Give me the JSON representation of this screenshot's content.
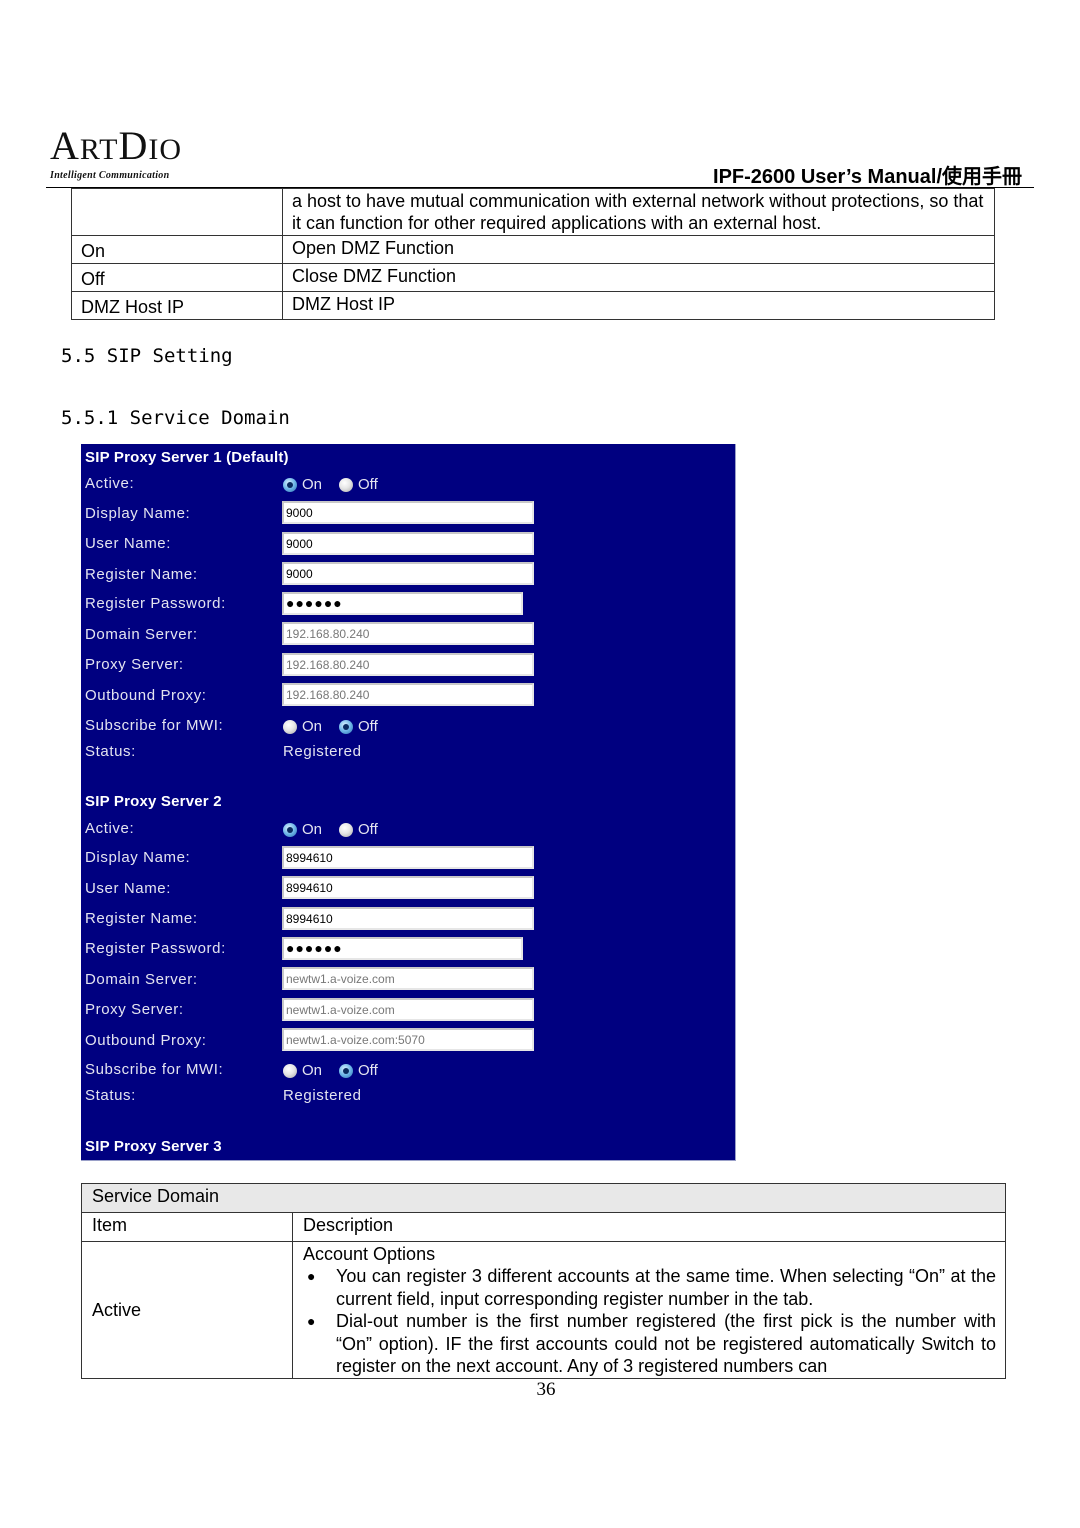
{
  "header": {
    "logo_main": "ArtDio",
    "logo_tagline": "Intelligent Communication",
    "manual_title": "IPF-2600 User’s Manual/使用手冊"
  },
  "dmz_table": {
    "rows": [
      {
        "item": "",
        "description": "a host to have mutual communication with external network without protections, so that it can function for other required applications with an external host."
      },
      {
        "item": "On",
        "description": "Open DMZ Function"
      },
      {
        "item": "Off",
        "description": "Close DMZ Function"
      },
      {
        "item": "DMZ Host IP",
        "description": "DMZ Host IP"
      }
    ]
  },
  "headings": {
    "section": "5.5 SIP Setting",
    "subsection": "5.5.1 Service Domain"
  },
  "sip_panel": {
    "colors": {
      "background": "#000080",
      "text": "#e4e4f0"
    },
    "labels": {
      "active": "Active:",
      "display_name": "Display Name:",
      "user_name": "User Name:",
      "register_name": "Register Name:",
      "register_password": "Register Password:",
      "domain_server": "Domain Server:",
      "proxy_server": "Proxy Server:",
      "outbound_proxy": "Outbound Proxy:",
      "subscribe_mwi": "Subscribe for MWI:",
      "status": "Status:",
      "on": "On",
      "off": "Off"
    },
    "servers": [
      {
        "title": "SIP Proxy Server 1 (Default)",
        "active": "On",
        "display_name": "9000",
        "user_name": "9000",
        "register_name": "9000",
        "register_password": "●●●●●●",
        "domain_server": "192.168.80.240",
        "proxy_server": "192.168.80.240",
        "outbound_proxy": "192.168.80.240",
        "subscribe_mwi": "Off",
        "status": "Registered"
      },
      {
        "title": "SIP Proxy Server 2",
        "active": "On",
        "display_name": "8994610",
        "user_name": "8994610",
        "register_name": "8994610",
        "register_password": "●●●●●●",
        "domain_server": "newtw1.a-voize.com",
        "proxy_server": "newtw1.a-voize.com",
        "outbound_proxy": "newtw1.a-voize.com:5070",
        "subscribe_mwi": "Off",
        "status": "Registered"
      },
      {
        "title": "SIP Proxy Server 3"
      }
    ]
  },
  "service_table": {
    "title": "Service Domain",
    "col_item": "Item",
    "col_description": "Description",
    "rows": [
      {
        "item": "Active",
        "description_title": "Account Options",
        "bullet_symbol": "●",
        "bullets": [
          "You can register 3 different accounts at the same time. When selecting “On” at the current field, input corresponding register number in the tab.",
          "Dial-out number is the first number registered (the first pick is the number with “On” option). IF the first accounts could not be registered automatically Switch to register on the next account. Any of 3 registered numbers can"
        ]
      }
    ]
  },
  "footer": {
    "page_number": "36"
  }
}
